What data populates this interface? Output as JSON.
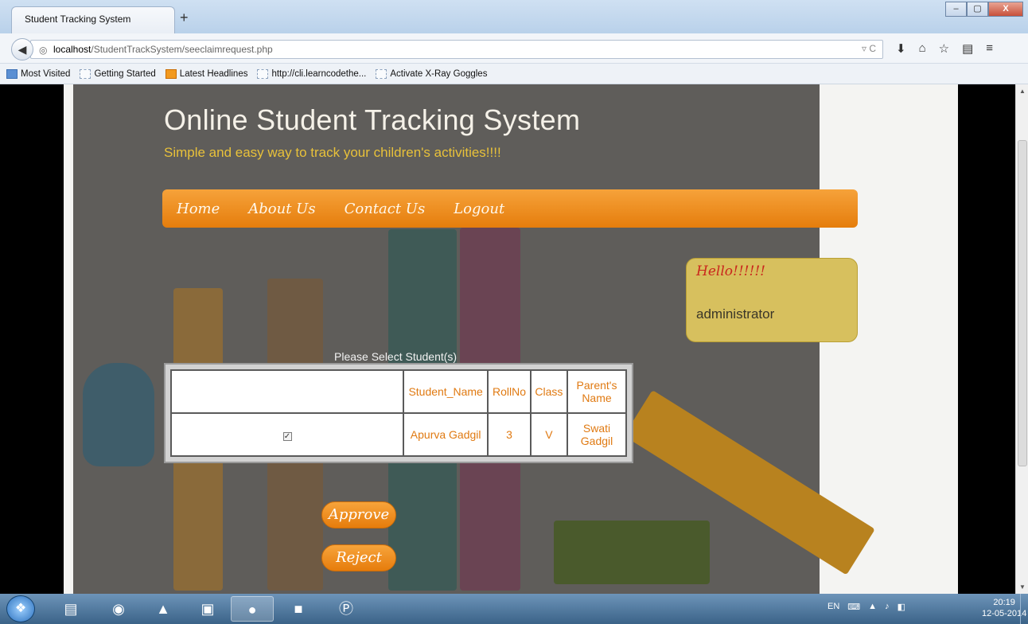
{
  "browser": {
    "tab_title": "Student Tracking System",
    "new_tab": "+",
    "url_host": "localhost",
    "url_path": "/StudentTrackSystem/seeclaimrequest.php",
    "window_buttons": [
      "–",
      "▢",
      "X"
    ]
  },
  "bookmarks": [
    "Most Visited",
    "Getting Started",
    "Latest Headlines",
    "http://cli.learncodethe...",
    "Activate X-Ray Goggles"
  ],
  "site": {
    "title": "Online Student Tracking System",
    "subtitle": "Simple and easy way to track your children's activities!!!!"
  },
  "menu": {
    "items": [
      "Home",
      "About Us",
      "Contact Us",
      "Logout"
    ]
  },
  "hello_box": {
    "greeting": "Hello!!!!!!",
    "user": "administrator"
  },
  "table": {
    "title": "Please Select Student(s)",
    "headers": [
      "",
      "Student_Name",
      "RollNo",
      "Class",
      "Parent's Name"
    ],
    "rows": [
      {
        "selected": true,
        "student_name": "Apurva Gadgil",
        "roll_no": "3",
        "class": "V",
        "parent_name": "Swati Gadgil"
      }
    ]
  },
  "actions": {
    "approve": "Approve",
    "reject": "Reject"
  },
  "taskbar": {
    "tray_lang": "EN",
    "time": "20:19",
    "date": "12-05-2014"
  },
  "colors": {
    "accent_orange": "#f39426",
    "title_yellow": "#e8c13a",
    "hello_red": "#c9261d"
  }
}
